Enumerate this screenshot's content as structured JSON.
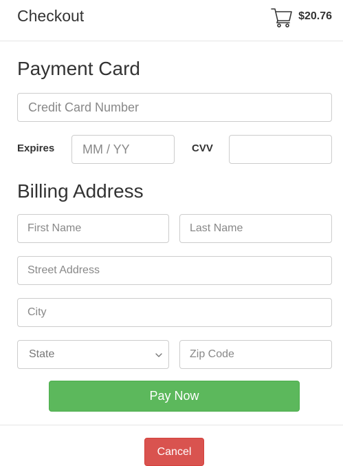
{
  "header": {
    "title": "Checkout",
    "cart_icon": "shopping-cart-icon",
    "cart_total": "$20.76"
  },
  "payment": {
    "title": "Payment Card",
    "card_number_placeholder": "Credit Card Number",
    "expires_label": "Expires",
    "expires_placeholder": "MM / YY",
    "cvv_label": "CVV",
    "cvv_value": ""
  },
  "billing": {
    "title": "Billing Address",
    "first_name_placeholder": "First Name",
    "last_name_placeholder": "Last Name",
    "street_placeholder": "Street Address",
    "city_placeholder": "City",
    "state_selected": "State",
    "zip_placeholder": "Zip Code"
  },
  "actions": {
    "pay_label": "Pay Now",
    "cancel_label": "Cancel"
  },
  "colors": {
    "pay_button": "#5cb85c",
    "cancel_button": "#d9534f",
    "border": "#cccccc",
    "text": "#333333"
  }
}
